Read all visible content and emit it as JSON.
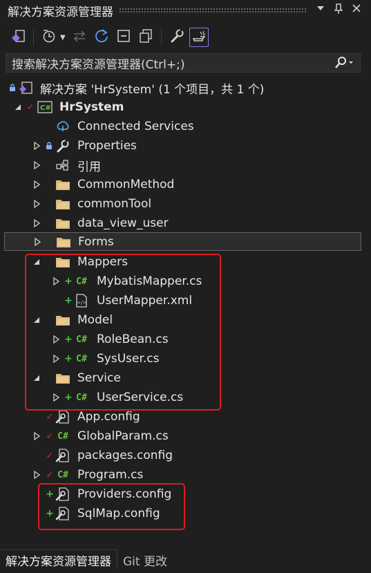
{
  "window": {
    "title": "解决方案资源管理器",
    "controls": [
      "chevron-down-icon",
      "pin-icon",
      "close-icon"
    ]
  },
  "toolbar": {
    "buttons": [
      "vs-switch-view-icon",
      "history-clock-icon",
      "sync-arrows-icon",
      "refresh-icon",
      "collapse-all-icon",
      "show-all-files-icon",
      "properties-wrench-icon",
      "preview-selected-icon"
    ]
  },
  "search": {
    "placeholder": "搜索解决方案资源管理器(Ctrl+;)"
  },
  "tree": {
    "solution": "解决方案 'HrSystem' (1 个项目，共 1 个)",
    "project": "HrSystem",
    "items": {
      "connected": "Connected Services",
      "properties": "Properties",
      "references": "引用",
      "commonMethod": "CommonMethod",
      "commonTool": "commonTool",
      "dataViewUser": "data_view_user",
      "forms": "Forms",
      "mappers": "Mappers",
      "mybatisMapper": "MybatisMapper.cs",
      "userMapper": "UserMapper.xml",
      "model": "Model",
      "roleBean": "RoleBean.cs",
      "sysUser": "SysUser.cs",
      "service": "Service",
      "userService": "UserService.cs",
      "appConfig": "App.config",
      "globalParam": "GlobalParam.cs",
      "packagesConfig": "packages.config",
      "program": "Program.cs",
      "providersConfig": "Providers.config",
      "sqlMapConfig": "SqlMap.config"
    },
    "cs_glyph": "C#"
  },
  "bottom_tabs": {
    "solution_explorer": "解决方案资源管理器",
    "git_changes": "Git 更改"
  },
  "colors": {
    "background": "#1f1f1f",
    "selection_border": "#646464",
    "highlight_box": "#e01b24",
    "added_plus": "#4ec24e",
    "checked_in": "#d13438",
    "csharp": "#68c23a",
    "active_toggle": "#8a7be8"
  }
}
